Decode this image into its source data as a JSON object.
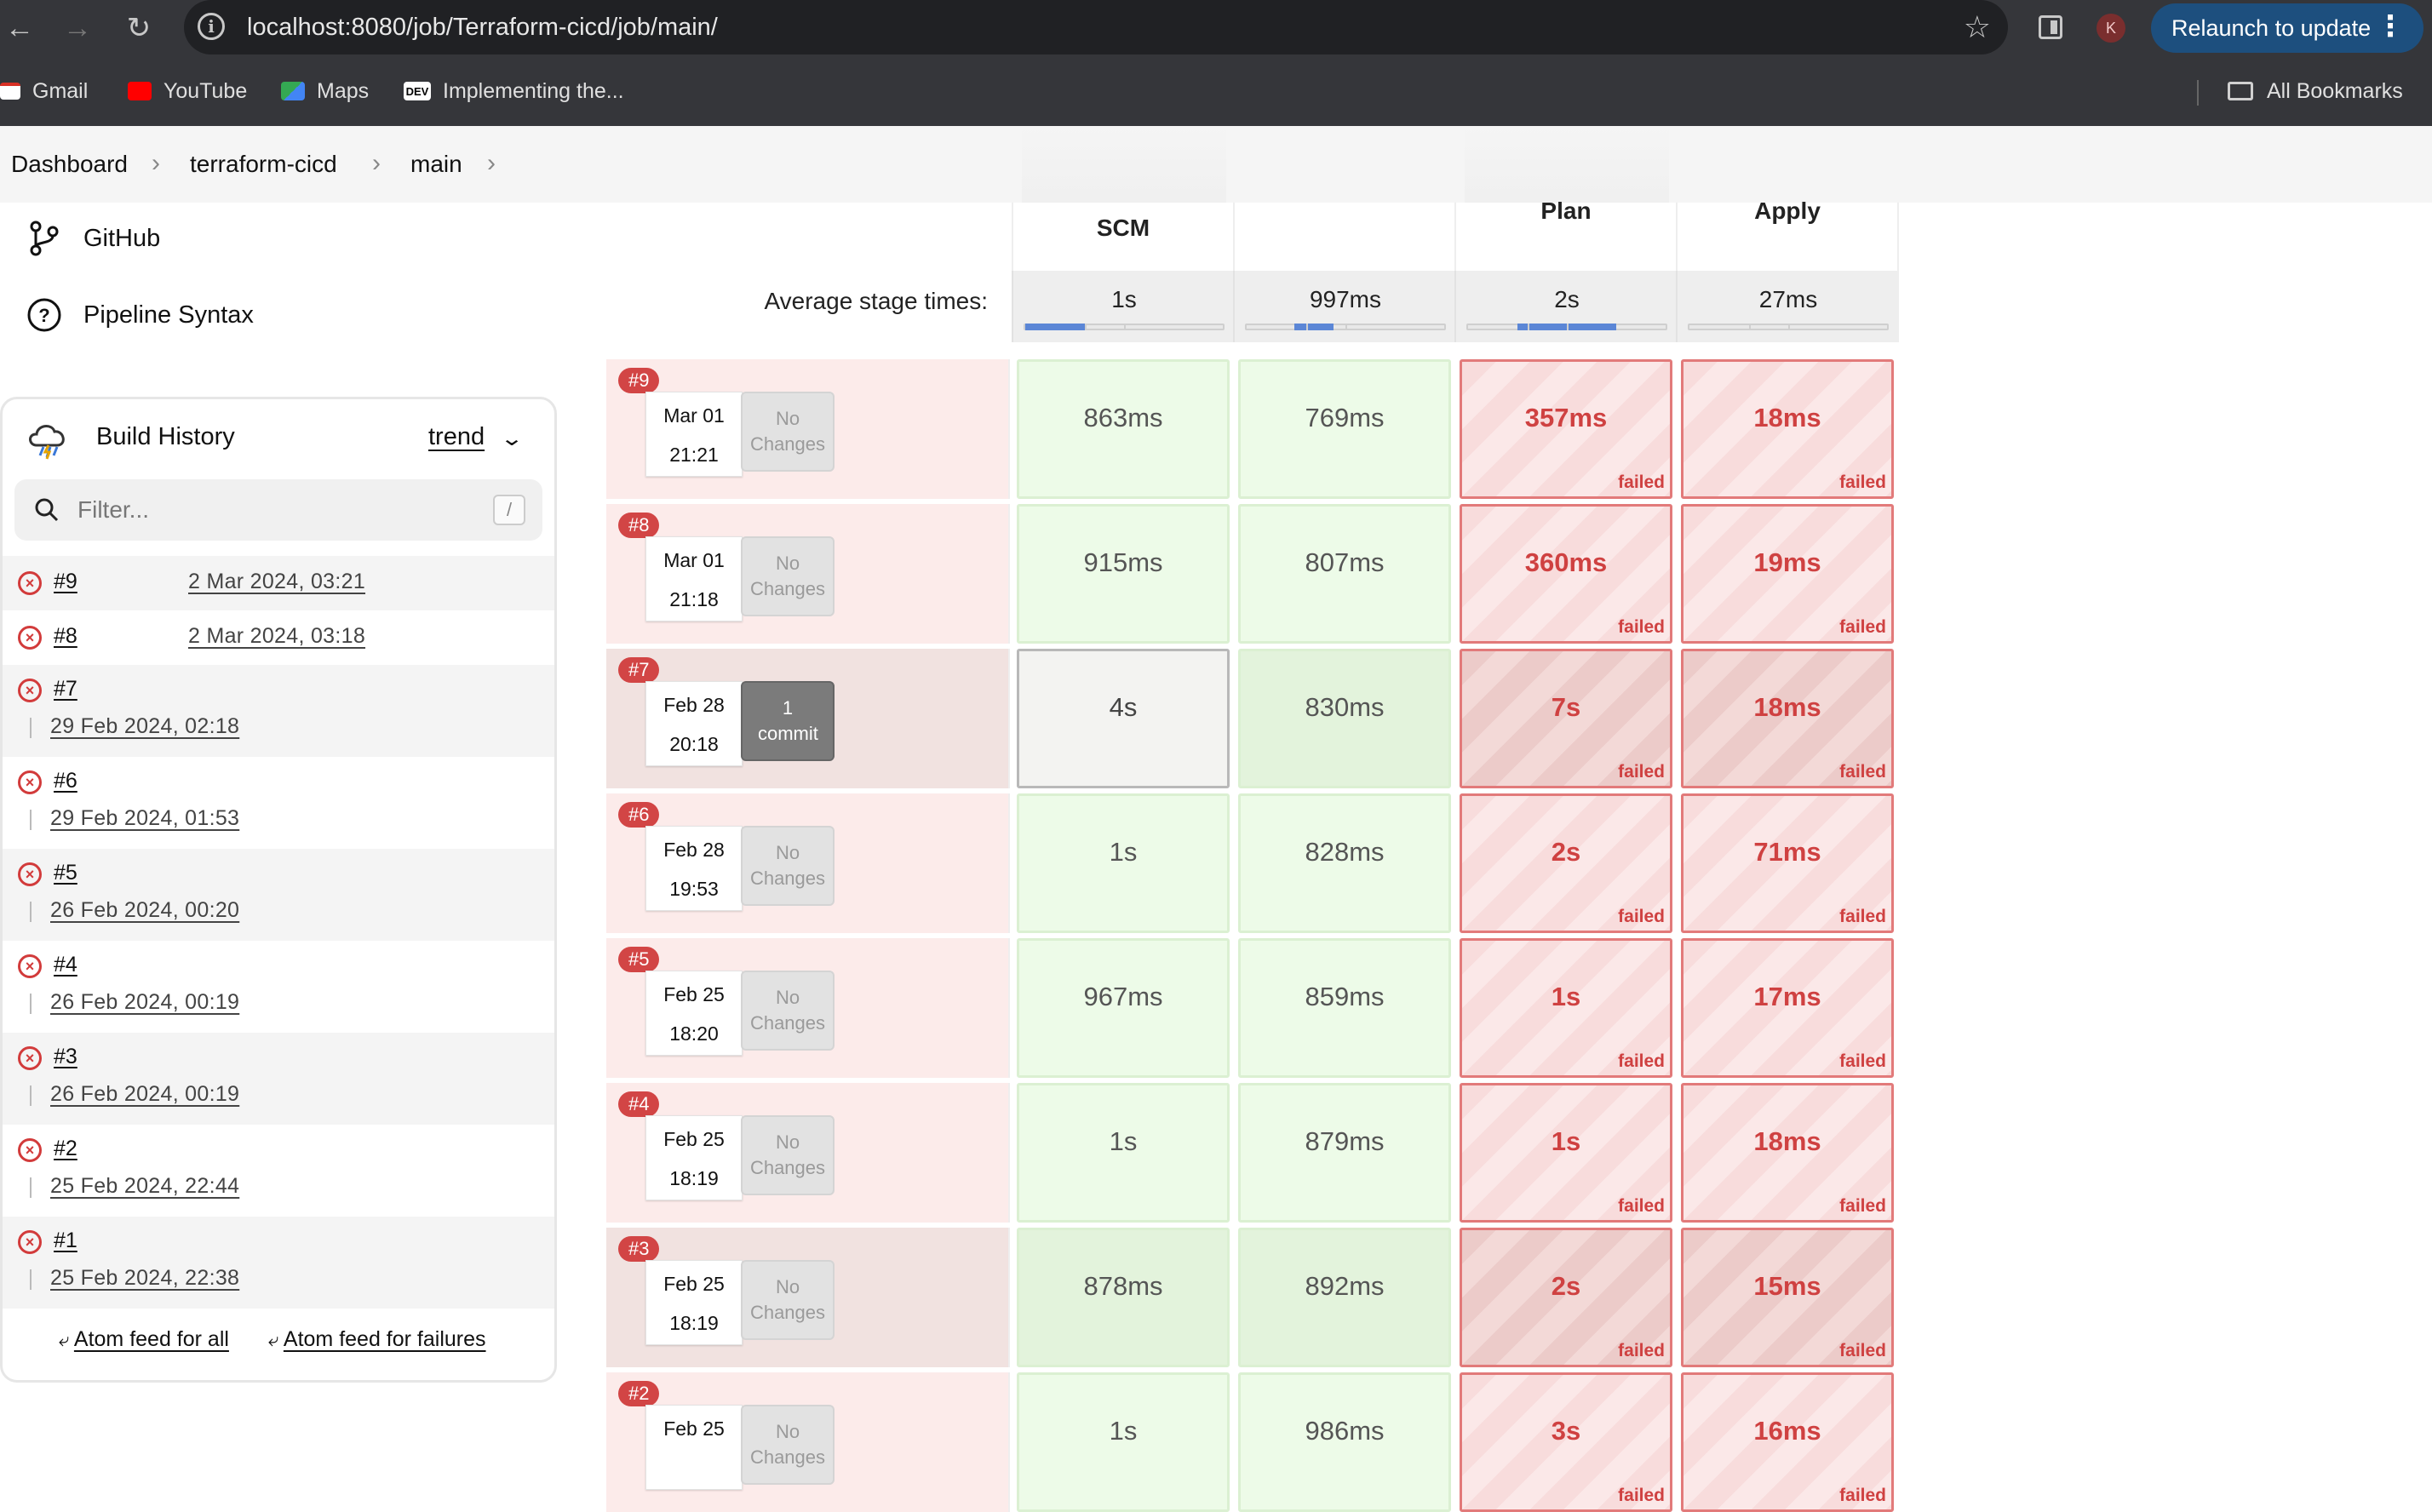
{
  "browser": {
    "url": "localhost:8080/job/Terraform-cicd/job/main/",
    "profile_initial": "K",
    "relaunch_label": "Relaunch to update",
    "bookmarks": [
      {
        "label": "Gmail",
        "icon": "gmail-icon",
        "color": "#d93025"
      },
      {
        "label": "YouTube",
        "icon": "youtube-icon",
        "color": "#ff0000"
      },
      {
        "label": "Maps",
        "icon": "maps-icon",
        "color": "#34a853"
      },
      {
        "label": "Implementing the...",
        "icon": "dev-icon",
        "color": "#000000"
      }
    ],
    "all_bookmarks_label": "All Bookmarks"
  },
  "breadcrumb": [
    "Dashboard",
    "terraform-cicd",
    "main"
  ],
  "side_links": [
    {
      "label": "GitHub",
      "icon": "git-branch-icon"
    },
    {
      "label": "Pipeline Syntax",
      "icon": "help-icon"
    }
  ],
  "build_history": {
    "title": "Build History",
    "trend_label": "trend",
    "filter_placeholder": "Filter...",
    "filter_shortcut": "/",
    "builds": [
      {
        "num": "#9",
        "date": "2 Mar 2024, 03:21",
        "status": "failed"
      },
      {
        "num": "#8",
        "date": "2 Mar 2024, 03:18",
        "status": "failed"
      },
      {
        "num": "#7",
        "date": "29 Feb 2024, 02:18",
        "status": "failed"
      },
      {
        "num": "#6",
        "date": "29 Feb 2024, 01:53",
        "status": "failed"
      },
      {
        "num": "#5",
        "date": "26 Feb 2024, 00:20",
        "status": "failed"
      },
      {
        "num": "#4",
        "date": "26 Feb 2024, 00:19",
        "status": "failed"
      },
      {
        "num": "#3",
        "date": "26 Feb 2024, 00:19",
        "status": "failed"
      },
      {
        "num": "#2",
        "date": "25 Feb 2024, 22:44",
        "status": "failed"
      },
      {
        "num": "#1",
        "date": "25 Feb 2024, 22:38",
        "status": "failed"
      }
    ],
    "atom_all": "Atom feed for all",
    "atom_failures": "Atom feed for failures"
  },
  "stage_view": {
    "stages": [
      "SCM",
      "",
      "Plan",
      "Apply"
    ],
    "avg_label": "Average stage times:",
    "avg_times": [
      "1s",
      "997ms",
      "2s",
      "27ms"
    ],
    "avg_fill_fraction": [
      0.3,
      0.2,
      0.5,
      0.0
    ],
    "failed_label": "failed",
    "runs": [
      {
        "badge": "#9",
        "date": "Mar 01",
        "time": "21:21",
        "changes": "No Changes",
        "times": [
          "863ms",
          "769ms",
          "357ms",
          "18ms"
        ],
        "status": [
          "success",
          "success",
          "failed",
          "failed"
        ]
      },
      {
        "badge": "#8",
        "date": "Mar 01",
        "time": "21:18",
        "changes": "No Changes",
        "times": [
          "915ms",
          "807ms",
          "360ms",
          "19ms"
        ],
        "status": [
          "success",
          "success",
          "failed",
          "failed"
        ]
      },
      {
        "badge": "#7",
        "date": "Feb 28",
        "time": "20:18",
        "changes": "1 commit",
        "times": [
          "4s",
          "830ms",
          "7s",
          "18ms"
        ],
        "status": [
          "success",
          "success",
          "failed",
          "failed"
        ]
      },
      {
        "badge": "#6",
        "date": "Feb 28",
        "time": "19:53",
        "changes": "No Changes",
        "times": [
          "1s",
          "828ms",
          "2s",
          "71ms"
        ],
        "status": [
          "success",
          "success",
          "failed",
          "failed"
        ]
      },
      {
        "badge": "#5",
        "date": "Feb 25",
        "time": "18:20",
        "changes": "No Changes",
        "times": [
          "967ms",
          "859ms",
          "1s",
          "17ms"
        ],
        "status": [
          "success",
          "success",
          "failed",
          "failed"
        ]
      },
      {
        "badge": "#4",
        "date": "Feb 25",
        "time": "18:19",
        "changes": "No Changes",
        "times": [
          "1s",
          "879ms",
          "1s",
          "18ms"
        ],
        "status": [
          "success",
          "success",
          "failed",
          "failed"
        ]
      },
      {
        "badge": "#3",
        "date": "Feb 25",
        "time": "18:19",
        "changes": "No Changes",
        "times": [
          "878ms",
          "892ms",
          "2s",
          "15ms"
        ],
        "status": [
          "success",
          "success",
          "failed",
          "failed"
        ]
      },
      {
        "badge": "#2",
        "date": "Feb 25",
        "time": "",
        "changes": "No Changes",
        "times": [
          "1s",
          "986ms",
          "3s",
          "16ms"
        ],
        "status": [
          "success",
          "success",
          "failed",
          "failed"
        ]
      }
    ]
  }
}
